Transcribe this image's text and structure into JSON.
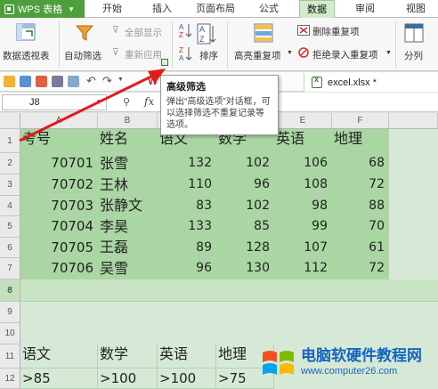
{
  "app": {
    "title": "WPS 表格"
  },
  "tabs": [
    "开始",
    "插入",
    "页面布局",
    "公式",
    "数据",
    "审阅",
    "视图"
  ],
  "ribbon": {
    "pivot_table": "数据透视表",
    "auto_filter": "自动筛选",
    "show_all": "全部显示",
    "reapply": "重新应用",
    "sort": "排序",
    "highlight_dup": "高亮重复项",
    "delete_dup": "删除重复项",
    "reject_dup": "拒绝录入重复项",
    "split": "分列"
  },
  "doc_tab": "excel.xlsx *",
  "formula_bar": {
    "cell_ref": "J8",
    "fx": "fx"
  },
  "tooltip": {
    "title": "高级筛选",
    "body": "弹出“高级选项”对话框，可以选择筛选不重复记录等选项。"
  },
  "columns": [
    "A",
    "B",
    "C",
    "D",
    "E",
    "F"
  ],
  "rows": [
    "1",
    "2",
    "3",
    "4",
    "5",
    "6",
    "7",
    "8",
    "9",
    "10",
    "11",
    "12"
  ],
  "table": {
    "headers": [
      "考号",
      "姓名",
      "语文",
      "数学",
      "英语",
      "地理"
    ],
    "rows": [
      [
        "70701",
        "张雪",
        "132",
        "102",
        "106",
        "68"
      ],
      [
        "70702",
        "王林",
        "110",
        "96",
        "108",
        "72"
      ],
      [
        "70703",
        "张静文",
        "83",
        "102",
        "98",
        "88"
      ],
      [
        "70704",
        "李昊",
        "133",
        "85",
        "99",
        "70"
      ],
      [
        "70705",
        "王磊",
        "89",
        "128",
        "107",
        "61"
      ],
      [
        "70706",
        "吴雪",
        "96",
        "130",
        "112",
        "72"
      ]
    ]
  },
  "criteria": {
    "headers": [
      "语文",
      "数学",
      "英语",
      "地理"
    ],
    "values": [
      ">85",
      ">100",
      ">100",
      ">75"
    ]
  },
  "watermark": {
    "title": "电脑软硬件教程网",
    "url": "www.computer26.com"
  },
  "colors": {
    "app_green": "#4d9f3c",
    "table_fill": "#a9d6a2",
    "arrow_red": "#e21b1b",
    "watermark_blue": "#1565c0"
  }
}
